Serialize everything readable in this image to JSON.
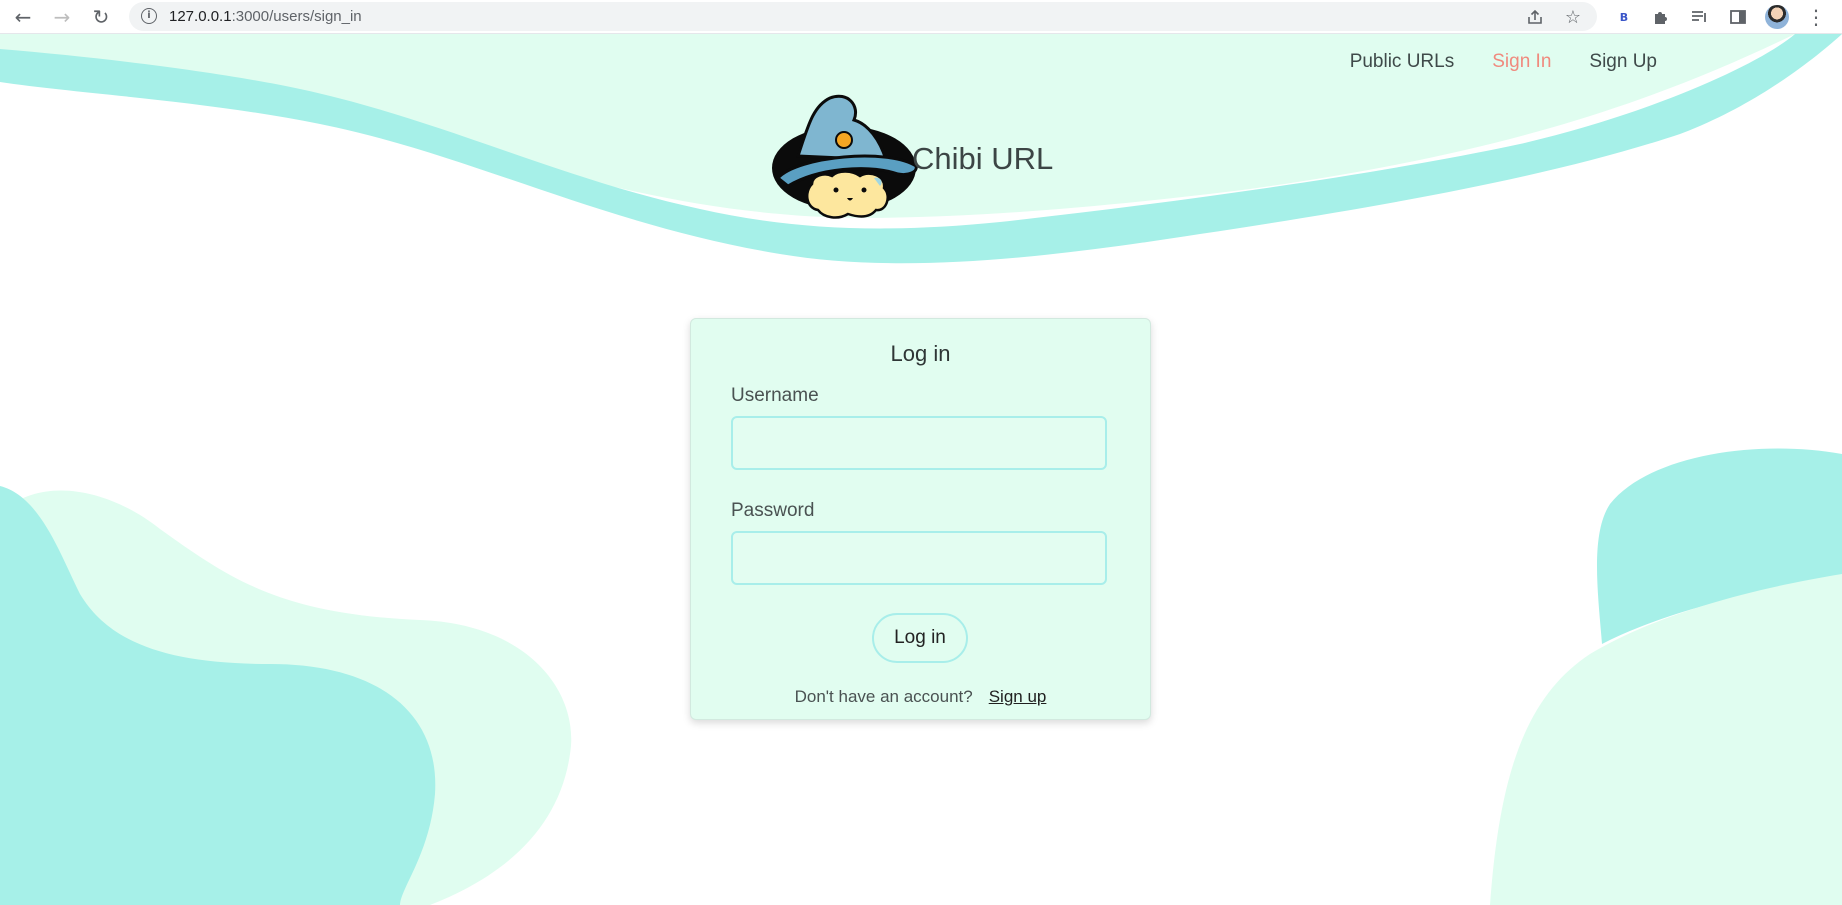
{
  "browser": {
    "url_host": "127.0.0.1",
    "url_path": ":3000/users/sign_in",
    "extension_badge": "B"
  },
  "nav": {
    "links": [
      {
        "label": "Public URLs",
        "active": false
      },
      {
        "label": "Sign In",
        "active": true
      },
      {
        "label": "Sign Up",
        "active": false
      }
    ]
  },
  "brand": {
    "title": "Chibi URL"
  },
  "login": {
    "title": "Log in",
    "username_label": "Username",
    "username_value": "",
    "password_label": "Password",
    "password_value": "",
    "submit_label": "Log in",
    "footer_text": "Don't have an account?",
    "signup_link": "Sign up"
  },
  "colors": {
    "accent_teal": "#a6f0e8",
    "mint": "#e0fdf0",
    "active_link": "#f08a7e"
  }
}
